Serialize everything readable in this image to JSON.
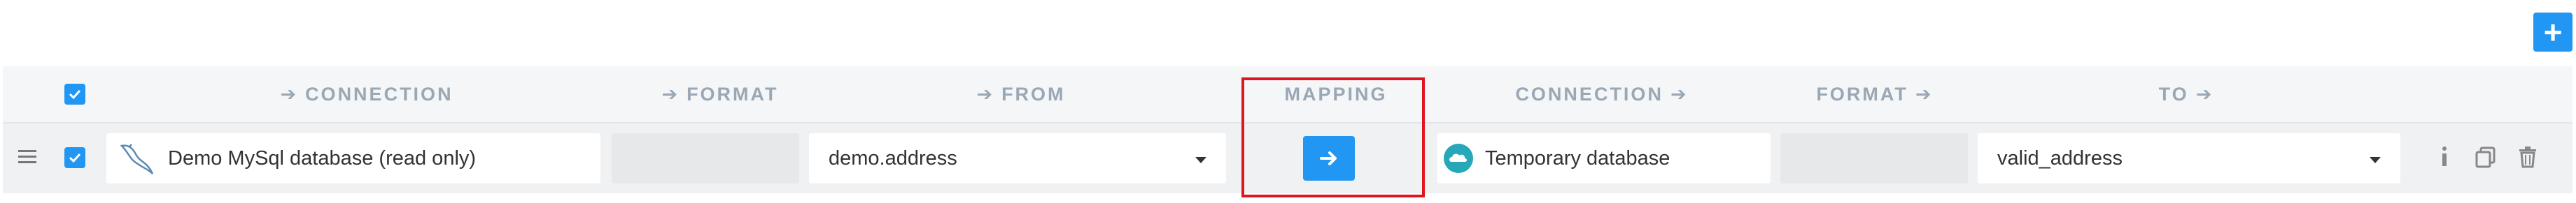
{
  "toolbar": {
    "add_label": "+",
    "add_icon": "plus-icon"
  },
  "header": {
    "src_connection": "CONNECTION",
    "src_format": "FORMAT",
    "from": "FROM",
    "mapping": "MAPPING",
    "dst_connection": "CONNECTION",
    "dst_format": "FORMAT",
    "to": "TO",
    "arrow": "➔"
  },
  "row": {
    "checked": true,
    "source_connection": {
      "label": "Demo MySql database (read only)",
      "icon": "mysql-dolphin-icon"
    },
    "source_format": "",
    "from": "demo.address",
    "target_connection": {
      "label": "Temporary database",
      "icon": "cloud-database-icon"
    },
    "target_format": "",
    "to": "valid_address",
    "actions": [
      "info-icon",
      "copy-icon",
      "trash-icon"
    ]
  },
  "colors": {
    "accent": "#2196f3",
    "highlight": "#e0161e",
    "header_text": "#9aa7b4"
  }
}
